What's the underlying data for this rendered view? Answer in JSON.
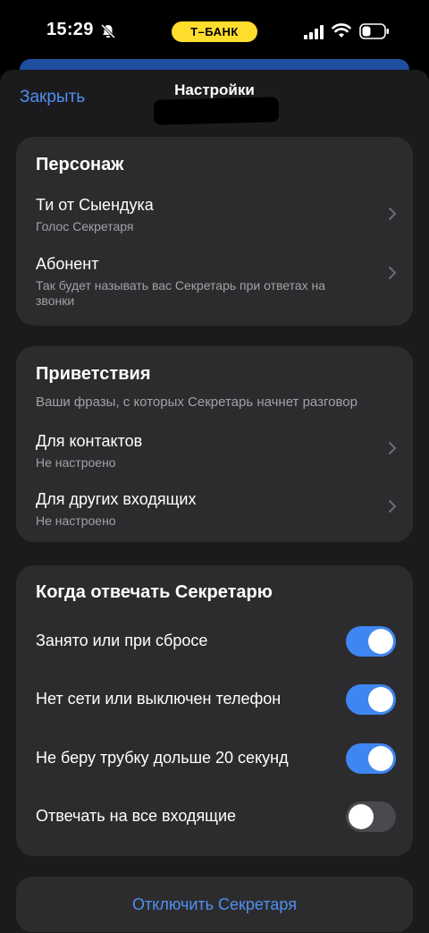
{
  "status_bar": {
    "time": "15:29",
    "carrier_badge": "Т–БАНК",
    "bell_icon": "bell-slash-icon",
    "signal_icon": "cellular-signal-icon",
    "wifi_icon": "wifi-icon",
    "battery_icon": "battery-icon"
  },
  "header": {
    "close_label": "Закрыть",
    "title": "Настройки"
  },
  "persona": {
    "title": "Персонаж",
    "items": [
      {
        "title": "Ти от Сыендука",
        "subtitle": "Голос Секретаря"
      },
      {
        "title": "Абонент",
        "subtitle": "Так будет называть вас Секретарь при ответах на звонки"
      }
    ]
  },
  "greetings": {
    "title": "Приветствия",
    "subtitle": "Ваши фразы, с которых Секретарь начнет разговор",
    "items": [
      {
        "title": "Для контактов",
        "subtitle": "Не настроено"
      },
      {
        "title": "Для других входящих",
        "subtitle": "Не настроено"
      }
    ]
  },
  "when_answer": {
    "title": "Когда отвечать Секретарю",
    "toggles": [
      {
        "label": "Занято или при сбросе",
        "on": true
      },
      {
        "label": "Нет сети или выключен телефон",
        "on": true
      },
      {
        "label": "Не беру трубку дольше 20 секунд",
        "on": true
      },
      {
        "label": "Отвечать на все входящие",
        "on": false
      }
    ]
  },
  "disable_button": "Отключить Секретаря",
  "colors": {
    "accent": "#4f8ff0",
    "toggle_on": "#3f86f2",
    "card": "#2c2c2e",
    "sheet": "#1b1b1d",
    "badge": "#ffdd2d"
  }
}
